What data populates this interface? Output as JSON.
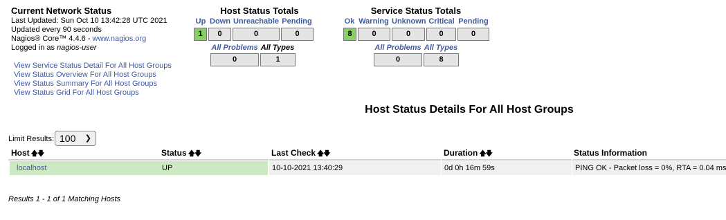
{
  "info": {
    "title": "Current Network Status",
    "last_updated": "Last Updated: Sun Oct 10 13:42:28 UTC 2021",
    "update_interval": "Updated every 90 seconds",
    "version_prefix": "Nagios® Core™ 4.4.6 - ",
    "site_link": "www.nagios.org",
    "logged_in_prefix": "Logged in as ",
    "user": "nagios-user"
  },
  "nav_links": [
    "View Service Status Detail For All Host Groups",
    "View Status Overview For All Host Groups",
    "View Status Summary For All Host Groups",
    "View Status Grid For All Host Groups"
  ],
  "host_totals": {
    "title": "Host Status Totals",
    "labels": [
      "Up",
      "Down",
      "Unreachable",
      "Pending"
    ],
    "values": [
      "1",
      "0",
      "0",
      "0"
    ],
    "all_problems_label": "All Problems",
    "all_types_label": "All Types",
    "all_problems": "0",
    "all_types": "1"
  },
  "service_totals": {
    "title": "Service Status Totals",
    "labels": [
      "Ok",
      "Warning",
      "Unknown",
      "Critical",
      "Pending"
    ],
    "values": [
      "8",
      "0",
      "0",
      "0",
      "0"
    ],
    "all_problems_label": "All Problems",
    "all_types_label": "All Types",
    "all_problems": "0",
    "all_types": "8"
  },
  "detail_title": "Host Status Details For All Host Groups",
  "limit": {
    "label": "Limit Results:",
    "value": "100"
  },
  "table": {
    "columns": [
      "Host",
      "Status",
      "Last Check",
      "Duration",
      "Status Information"
    ],
    "rows": [
      {
        "host": "localhost",
        "status": "UP",
        "last_check": "10-10-2021 13:40:29",
        "duration": "0d 0h 16m 59s",
        "info": "PING OK - Packet loss = 0%, RTA = 0.04 ms"
      }
    ]
  },
  "results_text": "Results 1 - 1 of 1 Matching Hosts",
  "colors": {
    "ok_green": "#88d066",
    "row_green": "#cde9c4",
    "link_blue": "#405aa0"
  }
}
